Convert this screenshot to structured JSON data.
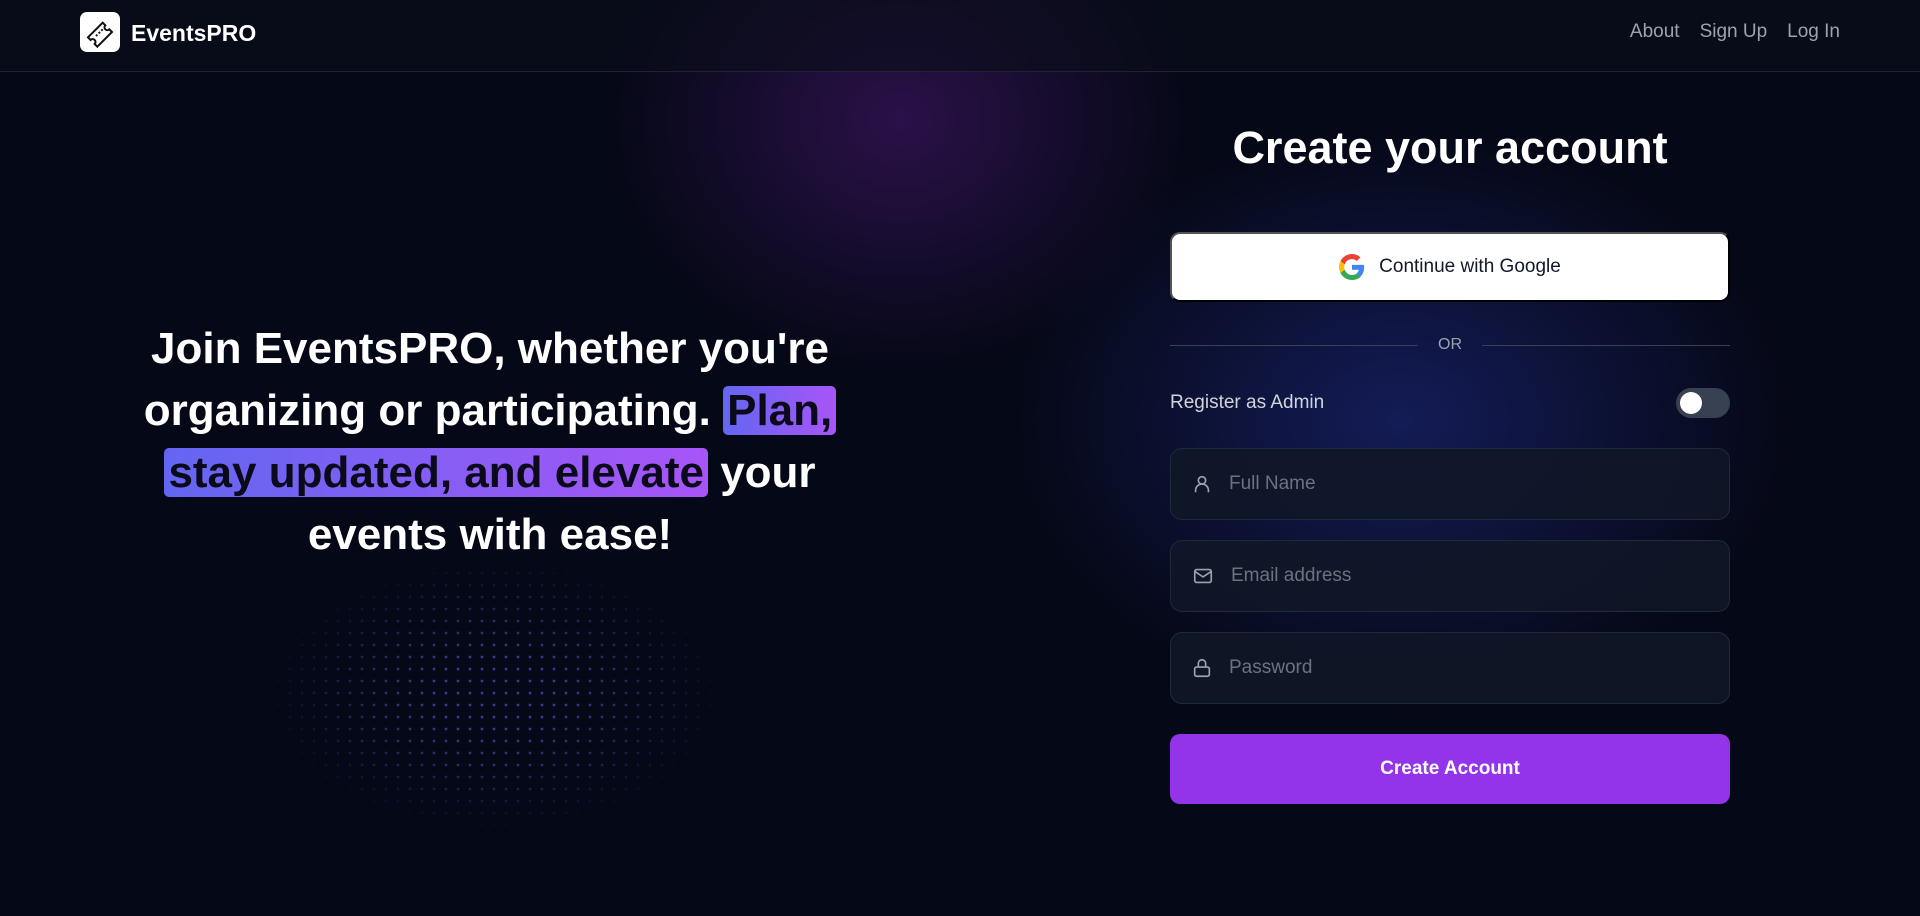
{
  "nav": {
    "brand": "EventsPRO",
    "links": [
      "About",
      "Sign Up",
      "Log In"
    ]
  },
  "hero": {
    "text_before": "Join EventsPRO, whether you're organizing or participating. ",
    "highlight": "Plan, stay updated, and elevate",
    "text_after": " your events with ease!"
  },
  "form": {
    "title": "Create your account",
    "google_label": "Continue with Google",
    "or_label": "OR",
    "admin_label": "Register as Admin",
    "admin_enabled": false,
    "full_name_placeholder": "Full Name",
    "email_placeholder": "Email address",
    "password_placeholder": "Password",
    "submit_label": "Create Account"
  },
  "colors": {
    "accent": "#9333ea",
    "highlight_start": "#6366f1",
    "highlight_end": "#a855f7"
  }
}
